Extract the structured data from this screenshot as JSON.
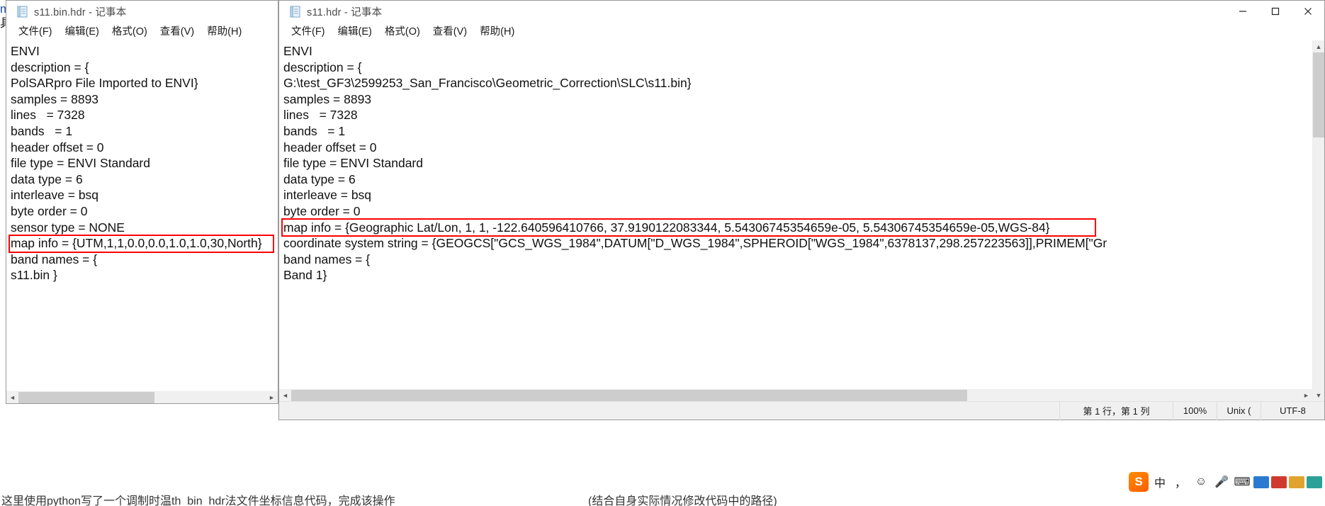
{
  "background": {
    "left_gutter": [
      "m",
      "具"
    ],
    "bottom_note_left": "这里使用python写了一个调制时温th_bin_hdr法文件坐标信息代码，完成该操作",
    "bottom_note_right": "(结合自身实际情况修改代码中的路径)"
  },
  "left_window": {
    "icon": "notepad-icon",
    "title": "s11.bin.hdr - 记事本",
    "menu": [
      "文件(F)",
      "编辑(E)",
      "格式(O)",
      "查看(V)",
      "帮助(H)"
    ],
    "lines": [
      "ENVI",
      "description = {",
      "PolSARpro File Imported to ENVI}",
      "samples = 8893",
      "lines   = 7328",
      "bands   = 1",
      "header offset = 0",
      "file type = ENVI Standard",
      "data type = 6",
      "interleave = bsq",
      "byte order = 0",
      "sensor type = NONE",
      "map info = {UTM,1,1,0.0,0.0,1.0,1.0,30,North}",
      "band names = {",
      "s11.bin }"
    ],
    "highlighted_line_index": 12,
    "highlight_color": "#ff0000"
  },
  "right_window": {
    "icon": "notepad-icon",
    "title": "s11.hdr - 记事本",
    "menu": [
      "文件(F)",
      "编辑(E)",
      "格式(O)",
      "查看(V)",
      "帮助(H)"
    ],
    "window_buttons": [
      "minimize",
      "maximize",
      "close"
    ],
    "lines": [
      "ENVI",
      "description = {",
      "G:\\test_GF3\\2599253_San_Francisco\\Geometric_Correction\\SLC\\s11.bin}",
      "samples = 8893",
      "lines   = 7328",
      "bands   = 1",
      "header offset = 0",
      "file type = ENVI Standard",
      "data type = 6",
      "interleave = bsq",
      "byte order = 0",
      "map info = {Geographic Lat/Lon, 1, 1, -122.640596410766, 37.9190122083344, 5.54306745354659e-05, 5.54306745354659e-05,WGS-84}",
      "coordinate system string = {GEOGCS[\"GCS_WGS_1984\",DATUM[\"D_WGS_1984\",SPHEROID[\"WGS_1984\",6378137,298.257223563]],PRIMEM[\"Gr",
      "band names = {",
      "Band 1}"
    ],
    "highlighted_line_index": 11,
    "highlight_color": "#ff0000",
    "status": {
      "cursor_position": "第 1 行，第 1 列",
      "zoom": "100%",
      "line_ending": "Unix (",
      "encoding": "UTF-8"
    }
  },
  "tray": {
    "items": [
      {
        "name": "sogou-logo",
        "glyph": "S"
      },
      {
        "name": "ime-chinese",
        "glyph": "中"
      },
      {
        "name": "ime-halfwidth",
        "glyph": "，"
      },
      {
        "name": "emoji",
        "glyph": "☺"
      },
      {
        "name": "microphone",
        "glyph": "🎤"
      },
      {
        "name": "keyboard",
        "glyph": "⌨"
      },
      {
        "name": "toolbox-blue",
        "glyph": ""
      },
      {
        "name": "toolbox-red",
        "glyph": ""
      },
      {
        "name": "toolbox-gold",
        "glyph": ""
      },
      {
        "name": "toolbox-teal",
        "glyph": ""
      }
    ]
  }
}
